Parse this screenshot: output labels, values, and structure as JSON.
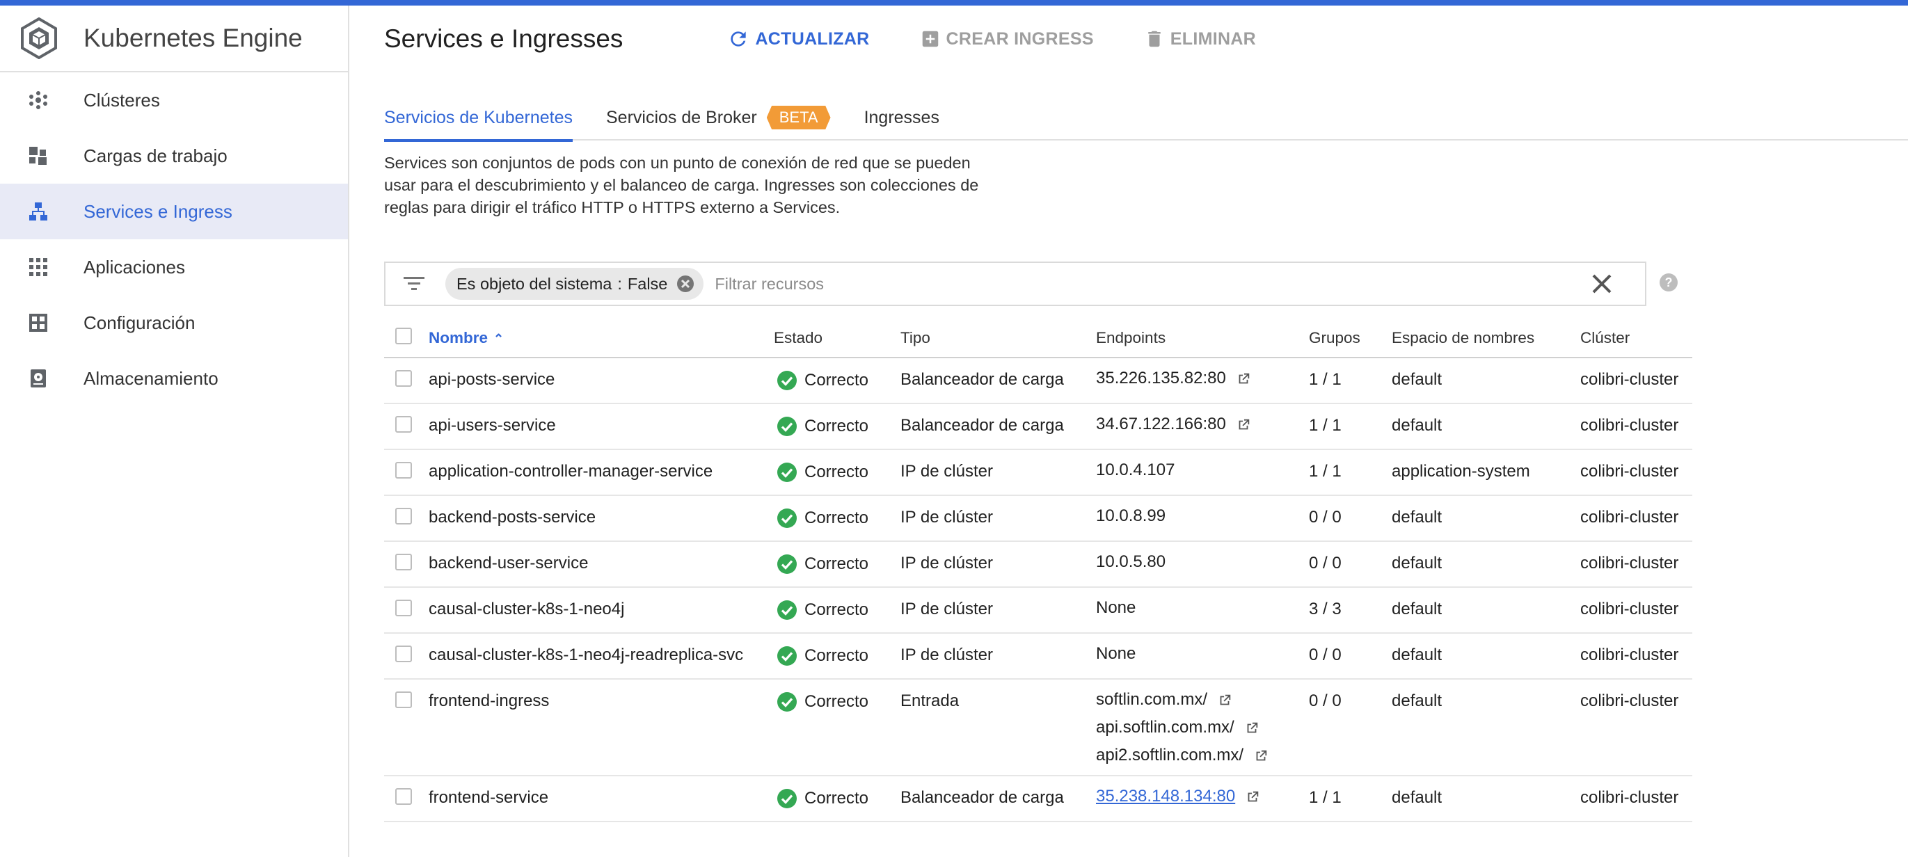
{
  "app": {
    "title": "Kubernetes Engine"
  },
  "sidebar": {
    "items": [
      {
        "label": "Clústeres",
        "icon": "clusters-icon",
        "active": false
      },
      {
        "label": "Cargas de trabajo",
        "icon": "workloads-icon",
        "active": false
      },
      {
        "label": "Services e Ingress",
        "icon": "services-icon",
        "active": true
      },
      {
        "label": "Aplicaciones",
        "icon": "apps-grid-icon",
        "active": false
      },
      {
        "label": "Configuración",
        "icon": "config-icon",
        "active": false
      },
      {
        "label": "Almacenamiento",
        "icon": "storage-icon",
        "active": false
      }
    ]
  },
  "header": {
    "title": "Services e Ingresses",
    "refresh_label": "ACTUALIZAR",
    "create_label": "CREAR INGRESS",
    "delete_label": "ELIMINAR"
  },
  "tabs": [
    {
      "label": "Servicios de Kubernetes",
      "active": true
    },
    {
      "label": "Servicios de Broker",
      "badge": "BETA",
      "active": false
    },
    {
      "label": "Ingresses",
      "active": false
    }
  ],
  "description": {
    "line1": "Services son conjuntos de pods con un punto de conexión de red que se pueden",
    "line2": "usar para el descubrimiento y el balanceo de carga. Ingresses son colecciones de",
    "line3": "reglas para dirigir el tráfico HTTP o HTTPS externo a Services."
  },
  "filter": {
    "chip_key": "Es objeto del sistema",
    "chip_sep": ":",
    "chip_value": "False",
    "placeholder": "Filtrar recursos"
  },
  "table": {
    "headers": {
      "name": "Nombre",
      "status": "Estado",
      "type": "Tipo",
      "endpoints": "Endpoints",
      "groups": "Grupos",
      "namespace": "Espacio de nombres",
      "cluster": "Clúster"
    },
    "rows": [
      {
        "name": "api-posts-service",
        "status": "Correcto",
        "type": "Balanceador de carga",
        "endpoints": [
          "35.226.135.82:80"
        ],
        "endpoint_external": true,
        "groups": "1 / 1",
        "namespace": "default",
        "cluster": "colibri-cluster"
      },
      {
        "name": "api-users-service",
        "status": "Correcto",
        "type": "Balanceador de carga",
        "endpoints": [
          "34.67.122.166:80"
        ],
        "endpoint_external": true,
        "groups": "1 / 1",
        "namespace": "default",
        "cluster": "colibri-cluster"
      },
      {
        "name": "application-controller-manager-service",
        "status": "Correcto",
        "type": "IP de clúster",
        "endpoints": [
          "10.0.4.107"
        ],
        "endpoint_external": false,
        "groups": "1 / 1",
        "namespace": "application-system",
        "cluster": "colibri-cluster"
      },
      {
        "name": "backend-posts-service",
        "status": "Correcto",
        "type": "IP de clúster",
        "endpoints": [
          "10.0.8.99"
        ],
        "endpoint_external": false,
        "groups": "0 / 0",
        "namespace": "default",
        "cluster": "colibri-cluster"
      },
      {
        "name": "backend-user-service",
        "status": "Correcto",
        "type": "IP de clúster",
        "endpoints": [
          "10.0.5.80"
        ],
        "endpoint_external": false,
        "groups": "0 / 0",
        "namespace": "default",
        "cluster": "colibri-cluster"
      },
      {
        "name": "causal-cluster-k8s-1-neo4j",
        "status": "Correcto",
        "type": "IP de clúster",
        "endpoints": [
          "None"
        ],
        "endpoint_external": false,
        "groups": "3 / 3",
        "namespace": "default",
        "cluster": "colibri-cluster"
      },
      {
        "name": "causal-cluster-k8s-1-neo4j-readreplica-svc",
        "status": "Correcto",
        "type": "IP de clúster",
        "endpoints": [
          "None"
        ],
        "endpoint_external": false,
        "groups": "0 / 0",
        "namespace": "default",
        "cluster": "colibri-cluster"
      },
      {
        "name": "frontend-ingress",
        "status": "Correcto",
        "type": "Entrada",
        "endpoints": [
          "softlin.com.mx/",
          "api.softlin.com.mx/",
          "api2.softlin.com.mx/"
        ],
        "endpoint_external": true,
        "groups": "0 / 0",
        "namespace": "default",
        "cluster": "colibri-cluster"
      },
      {
        "name": "frontend-service",
        "status": "Correcto",
        "type": "Balanceador de carga",
        "endpoints": [
          "35.238.148.134:80"
        ],
        "endpoint_external": true,
        "endpoint_link": true,
        "groups": "1 / 1",
        "namespace": "default",
        "cluster": "colibri-cluster"
      }
    ]
  },
  "colors": {
    "accent": "#3367d6",
    "success": "#34a853",
    "beta": "#f29b37",
    "disabled": "#9e9e9e"
  }
}
